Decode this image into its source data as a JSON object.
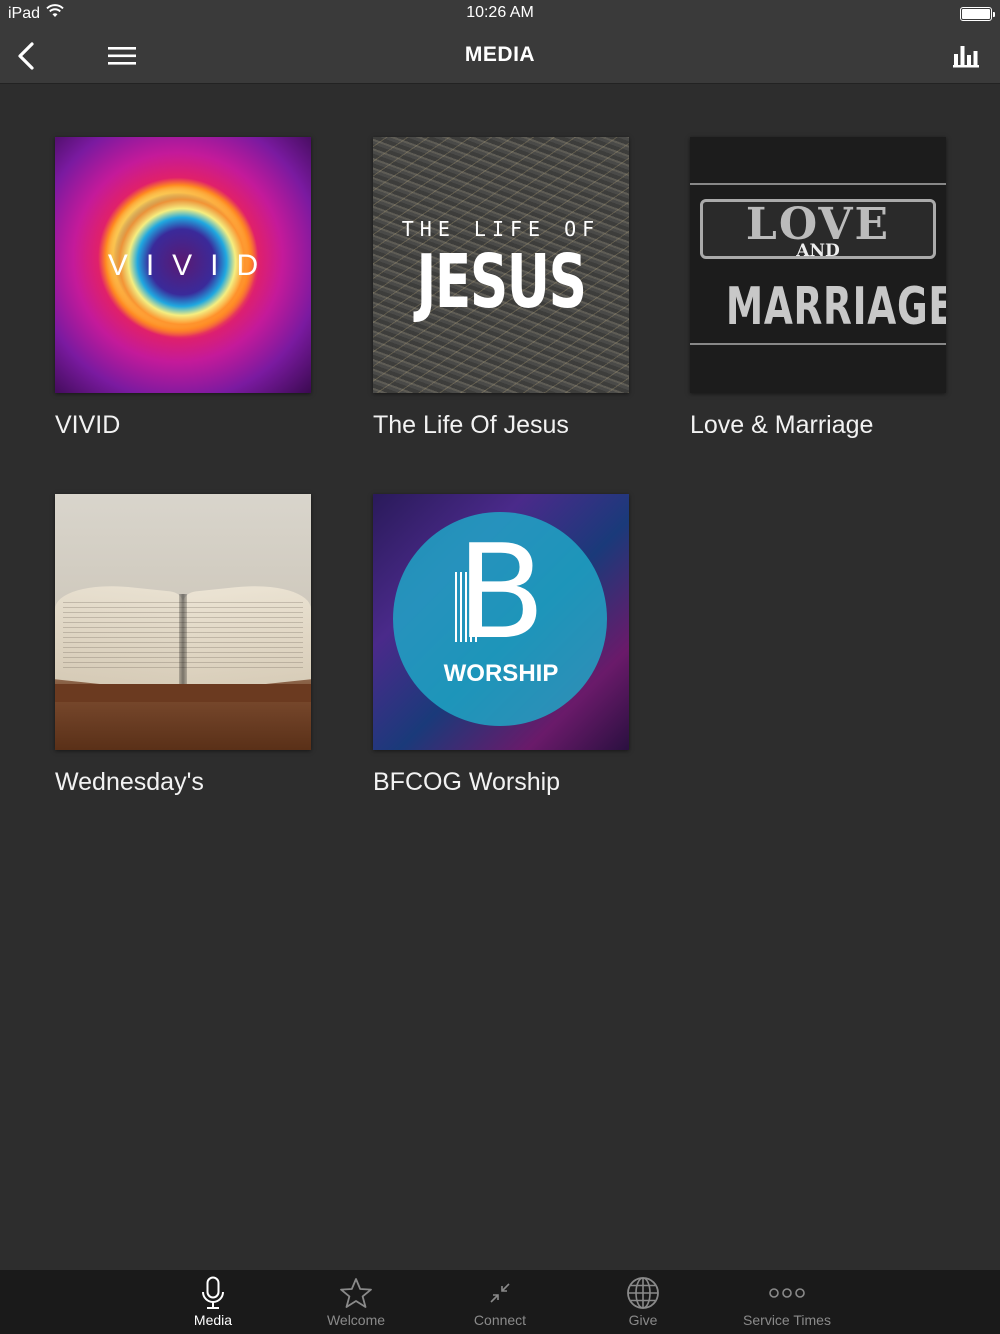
{
  "status_bar": {
    "device": "iPad",
    "time": "10:26 AM"
  },
  "nav": {
    "title": "MEDIA"
  },
  "media": {
    "items": [
      {
        "title": "VIVID",
        "art_text": "VIVID"
      },
      {
        "title": "The Life Of Jesus",
        "art_small": "THE LIFE OF",
        "art_big": "JESUS"
      },
      {
        "title": "Love & Marriage",
        "art_top": "LOVE",
        "art_mid": "AND",
        "art_bottom": "MARRIAGE"
      },
      {
        "title": "Wednesday's"
      },
      {
        "title": "BFCOG Worship",
        "art_letter": "B",
        "art_word": "WORSHIP"
      }
    ]
  },
  "tabs": [
    {
      "label": "Media",
      "icon": "microphone-icon",
      "active": true
    },
    {
      "label": "Welcome",
      "icon": "star-icon",
      "active": false
    },
    {
      "label": "Connect",
      "icon": "connect-arrows-icon",
      "active": false
    },
    {
      "label": "Give",
      "icon": "globe-icon",
      "active": false
    },
    {
      "label": "Service Times",
      "icon": "more-dots-icon",
      "active": false
    }
  ],
  "colors": {
    "background": "#2d2d2d",
    "nav_background": "#3a3a3a",
    "tab_background": "#1a1a1a",
    "tab_inactive": "#8a8a8a",
    "tab_active": "#ffffff"
  }
}
